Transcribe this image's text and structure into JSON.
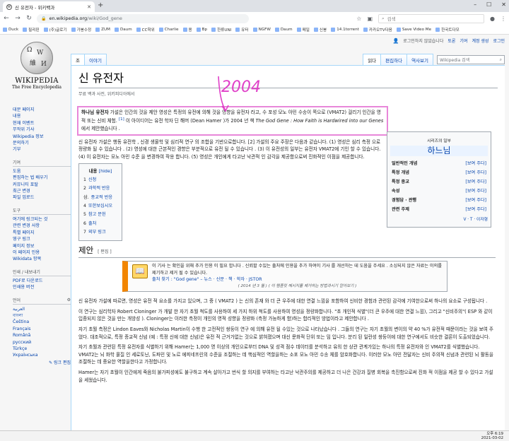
{
  "browser": {
    "tab_title": "신 유전자 - 위키백과",
    "tab_favicon": "W",
    "url_host": "en.wikipedia.org",
    "url_path": "/wiki/God_gene",
    "search_placeholder": "검색",
    "bookmarks": [
      "Duck",
      "필리핀",
      "(주)글로기",
      "가봉수정",
      "ZUM",
      "Daum",
      "CC학위",
      "Charlie",
      "용",
      "Bp",
      "한류UNI",
      "유터",
      "NGFW",
      "Daum",
      "메일",
      "신봉",
      "14.1torrent",
      "카카오TV다음",
      "Save Video Me",
      "한국트다모"
    ]
  },
  "wiki": {
    "personal": [
      "로그인하지 않았습니다",
      "토론",
      "기여",
      "계정 생성",
      "로그인"
    ],
    "logo_wordmark": "WIKIPEDIA",
    "logo_tagline": "The Free Encyclopedia",
    "sidebar": {
      "nav": [
        "대문 페이지",
        "내용",
        "현재 이벤트",
        "무작위 기사",
        "Wikipedia 정보",
        "문의하기",
        "기부"
      ],
      "help_header": "기여",
      "help": [
        "도움",
        "편집하는 법 배우기",
        "커뮤니티 포탈",
        "최근 변경",
        "파일 업로드"
      ],
      "tools_header": "도구",
      "tools": [
        "여기에 링크되는 것",
        "관련 변경 사항",
        "특별 페이지",
        "영구 링크",
        "페이지 정보",
        "이 페이지 인용",
        "Wikidata 항목"
      ],
      "print_header": "인쇄 / 내보내기",
      "print": [
        "PDF로 다운로드",
        "인쇄용 버전"
      ],
      "lang_header": "언어",
      "langs": [
        "العربية",
        "বাংলা",
        "Čeština",
        "Français",
        "Română",
        "русский",
        "Türkçe",
        "Українська"
      ],
      "edit_links": "링크 편집"
    },
    "tabs_left": [
      "조",
      "이야기"
    ],
    "tabs_right": [
      "읽다",
      "편집하다",
      "역사보기"
    ],
    "search_placeholder": "Wikipedia 검색",
    "title": "신 유전자",
    "subtitle": "무료 백과 사전, 위키피디아에서",
    "lead_bold": "하나님 유전자",
    "lead_text": " 가설은 인간의 것을 제안 영성은 특정의 유전에 의해 것을 영향을 유전자 라고, 수 포성 모노 아민 수송이 쪽으로 (VMAT2) 걸리기 인간을 영적 또는 신비 체험. ",
    "lead_ref": "[1]",
    "lead_text2": " 이 아이디어는 유전 학자 딘 해머 (Dean Hamer )가 2004 년 책 ",
    "lead_book": "The God Gene : How Faith is Hardwired into our Genes",
    "lead_text3": " 에서 제안했습니다 .",
    "para1": "신 유전자 가설은 행동 유전학 , 신경 생물학 및 심리적 연구 의 조합을 기반으로합니다. [2] 가설의 주요 주장은 다음과 같습니다. (1) 영성은 심리 측정 으로 정량화 될 수 있습니다 . (2) 영성에 대한 근본적인 경향은 부분적으로 유전 될 수 있습니다 . (3) 이 유전성의 일부는 유전자 VMAT2에 기인 할 수 있습니다. (4) 이 유전자는 모노 아민 수준 을 변경하여 작용 합니다. (5) 영성은 개인에게 타고난 낙관적 인 감각을 제공함으로써 진화적인 이점을 제공합니다.",
    "infobox": {
      "subheader": "시리즈의 일부",
      "title": "하느님",
      "rows": [
        {
          "label": "일반적인 개념",
          "link": "[보여 주다]"
        },
        {
          "label": "특정 개념",
          "link": "[보여 주다]"
        },
        {
          "label": "특정 종교",
          "link": "[보여 주다]"
        },
        {
          "label": "속성",
          "link": "[보여 주다]"
        },
        {
          "label": "경험담 · 관행",
          "link": "[보여 주다]"
        },
        {
          "label": "관련 주제",
          "link": "[보여 주다]"
        }
      ],
      "vte": "V · T · 이자형"
    },
    "toc": {
      "header": "내용",
      "hide": "[hide]",
      "items": [
        {
          "n": "1",
          "t": "신청"
        },
        {
          "n": "2",
          "t": "과학적 반응"
        },
        {
          "n": "삼.",
          "t": "종교적 반응"
        },
        {
          "n": "4",
          "t": "또한보십시오"
        },
        {
          "n": "5",
          "t": "참고 문헌"
        },
        {
          "n": "6",
          "t": "출처"
        },
        {
          "n": "7",
          "t": "외부 링크"
        }
      ]
    },
    "section1": {
      "title": "제안",
      "edit": "[ 편집 ]"
    },
    "ambox": {
      "line1": "이 기사 는 확인을 위해 추가 인용 이 필요 합니다 . 신뢰할 수있는 출처에 인용을 추가 하여이 기사 를 개선하는 데 도움을 주세요 . 소싱되지 않은 자료는 이의를 제기하고 제거 될 수 있습니다.",
      "line2": "출처 찾기 : \"God gene\" – 뉴스 · 신문 · 책 · 학자 · JSTOR",
      "date": "( 2014 년 3 월 ) ( 이 템플릿 메시지를 제거하는 방법과시기 알아보기 )"
    },
    "paras": [
      "신 유전자 가설에 따르면, 영성은 유전 적 요소를 가지고 있으며, 그 중 ( VMAT2 ) 는 신의 존재 와 더 큰 우주에 대한 연결 느낌을 포함하여 신비한 경험과 관련된 감각에 기여한으로써 하나의 요소로 구성됩니다 .",
      "이 연구는 심리학자 Robert Cloninger 가 개발 한 자기 초월 척도를 사용하여 세 가지 하위 척도를 사용하여 영성을 정량화합니다. \"초 개인적 식별\"(더 큰 우주에 대한 연결 느낌), 그리고 \"신비주의\"( ESP 와 같이 입증되지 않은 것을 만는 개방성 ). Cloninger는 이러한 측정이 개인의 영적 성향을 정량화 (측정 가능하게 함)하는 합리적인 방법이라고 제안합니다 .",
      "자기 초월 측정은 Lindon Eaves와 Nicholas Martin이 수행 한 고전적인 쌍둥이 연구 에 의해 유전 될 수있는 것으로 나타났습니다 . 그들의 연구는 자기 초월의 변이의 약 40 %가 유전적 때문이라는 것을 보여 주었다. 대조적으로, 특정 종교적 신념 (예 : 특정 신에 대한 신념)은 유전 적 근거가없는 것으로 밝혀졌으며 대신 문화적 단위 또는 밈 입니다. 분리 된 일란성 쌍둥이에 대한 연구에서도 비슷한 결론이 도출되었습니다.",
      "자기 초월과 관련된 특정 유전자를 식별하기 위해 Hamer는 1,000 명 이상의 개인으로부터 DNA 및 성격 점수 데이터를 분석하고 유의 한 상관 관계가있는 하나의 특정 유전자와 인 VMAT2를 식별했습니다. VMAT2는 뇌 화학 물질 인 세로토닌, 도파민 및 노르 에피네프린의 수준을 조절하는 데 핵심적인 역할을하는 소포 모노 아민 수송 체를 암호화합니다. 이러한 모노 아민 전달자는 신비 주의적 신념과 관련된 뇌 활동을 조절하는 데 중요한 역할을한다고 가정합니다.",
      "Hamer는 자기 초월이 인간에게 죽음의 불가피성에도 불구하고 계속 살아가고 번식 할 의지를 부여하는 타고난 낙관주의를 제공하고 더 나은 건강과 질병 회복을 촉진함으로써 진화 적 이점을 제공 할 수 있다고 가설을 세웠습니다."
    ],
    "annotation": "2004"
  },
  "taskbar": {
    "time": "오후 6:19",
    "date": "2021-03-02"
  },
  "colors": {
    "annotation_magenta": "#e040c8",
    "link": "#0645ad",
    "ambox_orange": "#f28500"
  }
}
